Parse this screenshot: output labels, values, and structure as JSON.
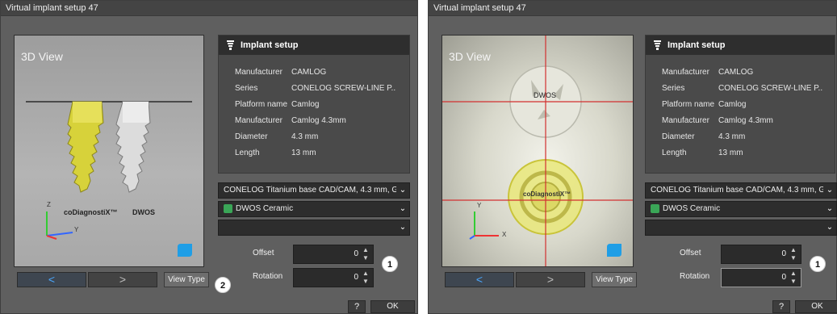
{
  "left": {
    "title": "Virtual implant setup 47",
    "view_label": "3D View",
    "labels_3d": {
      "implant_a": "coDiagnostiX™",
      "implant_b": "DWOS",
      "axis_z": "Z",
      "axis_y": "Y"
    },
    "panel_title": "Implant setup",
    "properties": [
      {
        "label": "Manufacturer",
        "value": "CAMLOG"
      },
      {
        "label": "Series",
        "value": "CONELOG SCREW-LINE P..."
      },
      {
        "label": "Platform name",
        "value": "Camlog"
      },
      {
        "label": "Manufacturer",
        "value": "Camlog 4.3mm"
      },
      {
        "label": "Diameter",
        "value": "4.3 mm"
      },
      {
        "label": "Length",
        "value": "13 mm"
      }
    ],
    "dropdown_1": "CONELOG Titanium base CAD/CAM,  4.3 mm, G...",
    "dropdown_2": "DWOS Ceramic",
    "dropdown_3": "",
    "offset_label": "Offset",
    "offset_value": "0",
    "rotation_label": "Rotation",
    "rotation_value": "0",
    "badge_1": "1",
    "badge_2": "2",
    "prev_glyph": "<",
    "next_glyph": ">",
    "view_type_label": "View Type",
    "help_glyph": "?",
    "ok_label": "OK"
  },
  "right": {
    "title": "Virtual implant setup 47",
    "view_label": "3D View",
    "labels_3d": {
      "top_label": "DWOS",
      "bottom_label": "coDiagnostiX™",
      "axis_y": "Y",
      "axis_x": "X"
    },
    "panel_title": "Implant setup",
    "properties": [
      {
        "label": "Manufacturer",
        "value": "CAMLOG"
      },
      {
        "label": "Series",
        "value": "CONELOG SCREW-LINE P..."
      },
      {
        "label": "Platform name",
        "value": "Camlog"
      },
      {
        "label": "Manufacturer",
        "value": "Camlog 4.3mm"
      },
      {
        "label": "Diameter",
        "value": "4.3 mm"
      },
      {
        "label": "Length",
        "value": "13 mm"
      }
    ],
    "dropdown_1": "CONELOG Titanium base CAD/CAM,  4.3 mm, G...",
    "dropdown_2": "DWOS Ceramic",
    "dropdown_3": "",
    "offset_label": "Offset",
    "offset_value": "0",
    "rotation_label": "Rotation",
    "rotation_value": "0",
    "badge_1": "1",
    "prev_glyph": "<",
    "next_glyph": ">",
    "view_type_label": "View Type",
    "help_glyph": "?",
    "ok_label": "OK"
  },
  "icons": {
    "panel_header": "implant-icon",
    "dropdown_chevron": "chevron-down-icon",
    "material": "dwos-logo-icon",
    "spin": "spin-arrows-icon",
    "cube": "view-cube-icon"
  },
  "colors": {
    "dialog_bg": "#5f5f5f",
    "titlebar": "#444444",
    "panel_header": "#2e2e2e",
    "nav_active": "#4aa8ff",
    "implant_yellow": "#d9d43a",
    "crosshair": "#d23030",
    "axis_red": "#e33",
    "axis_green": "#3c3",
    "axis_blue": "#36f"
  }
}
